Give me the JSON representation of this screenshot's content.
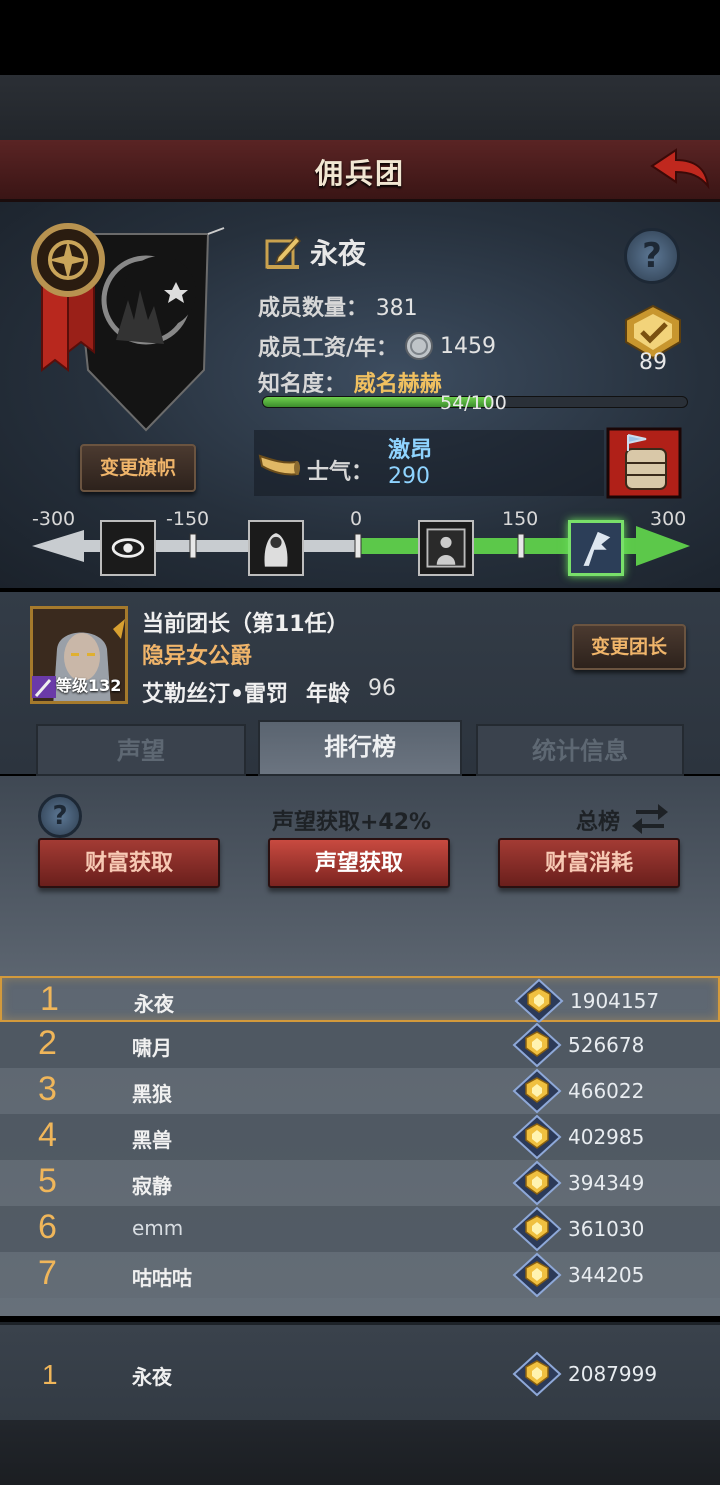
{
  "header": {
    "title": "佣兵团",
    "back_icon": "back-arrow-icon"
  },
  "guild": {
    "name": "永夜",
    "change_flag_label": "变更旗帜",
    "members_label": "成员数量：",
    "members_value": "381",
    "salary_label": "成员工资/年：",
    "salary_value": "1459",
    "fame_label": "知名度：",
    "fame_value": "威名赫赫",
    "fame_progress_text": "54/100",
    "fame_progress": 0.54,
    "rank_badge_value": "89",
    "morale_label": "士气：",
    "morale_state": "激昂",
    "morale_value": "290"
  },
  "morale_track": {
    "ticks": [
      "-300",
      "-150",
      "0",
      "150",
      "300"
    ],
    "value": 290,
    "min": -300,
    "max": 300
  },
  "leader": {
    "title": "当前团长（第11任）",
    "class": "隐异女公爵",
    "level_label": "等级132",
    "name": "艾勒丝汀•雷罚",
    "age_label": "年龄",
    "age_value": "96",
    "change_leader_label": "变更团长"
  },
  "tabs": [
    {
      "label": "声望",
      "active": false
    },
    {
      "label": "排行榜",
      "active": true
    },
    {
      "label": "统计信息",
      "active": false
    }
  ],
  "leaderboard": {
    "bonus_text": "声望获取+42%",
    "scope_label": "总榜",
    "categories": [
      {
        "label": "财富获取",
        "active": false
      },
      {
        "label": "声望获取",
        "active": true
      },
      {
        "label": "财富消耗",
        "active": false
      }
    ],
    "rows": [
      {
        "rank": "1",
        "name": "永夜",
        "score": "1904157"
      },
      {
        "rank": "2",
        "name": "啸月",
        "score": "526678"
      },
      {
        "rank": "3",
        "name": "黑狼",
        "score": "466022"
      },
      {
        "rank": "4",
        "name": "黑兽",
        "score": "402985"
      },
      {
        "rank": "5",
        "name": "寂静",
        "score": "394349"
      },
      {
        "rank": "6",
        "name": "emm",
        "score": "361030"
      },
      {
        "rank": "7",
        "name": "咕咕咕",
        "score": "344205"
      }
    ],
    "my_rank": {
      "rank": "1",
      "name": "永夜",
      "score": "2087999"
    }
  },
  "colors": {
    "header_red": "#5a2424",
    "accent_gold": "#f0b56a",
    "morale_blue": "#8fd4ff",
    "track_green": "#5cc84a",
    "button_red": "#a33b34"
  }
}
